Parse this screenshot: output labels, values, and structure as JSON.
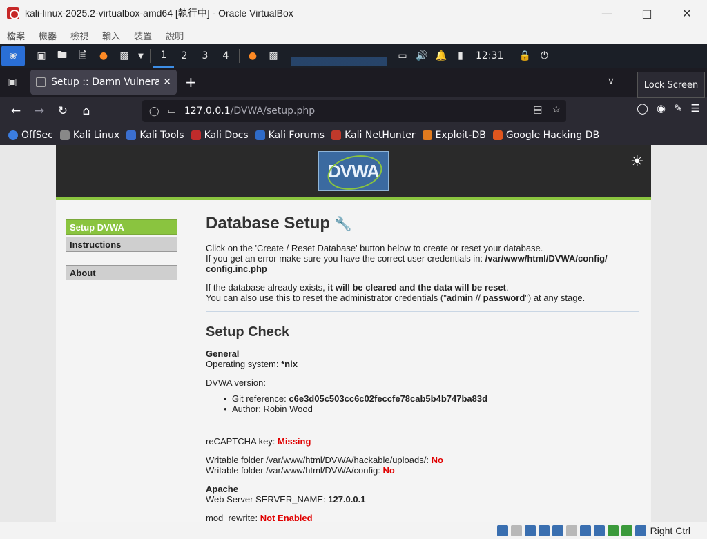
{
  "vbox": {
    "title": "kali-linux-2025.2-virtualbox-amd64 [執行中] - Oracle VirtualBox",
    "menus": [
      "檔案",
      "機器",
      "檢視",
      "輸入",
      "裝置",
      "說明"
    ],
    "host_key": "Right Ctrl"
  },
  "panel": {
    "workspaces": [
      "1",
      "2",
      "3",
      "4"
    ],
    "clock": "12:31"
  },
  "firefox": {
    "tab_title": "Setup :: Damn Vulnerable",
    "tooltip": "Lock Screen",
    "url_host": "127.0.0.1",
    "url_path": "/DVWA/setup.php",
    "bookmarks": [
      "OffSec",
      "Kali Linux",
      "Kali Tools",
      "Kali Docs",
      "Kali Forums",
      "Kali NetHunter",
      "Exploit-DB",
      "Google Hacking DB"
    ]
  },
  "dvwa": {
    "logo_text": "DVWA",
    "menu": [
      "Setup DVWA",
      "Instructions",
      "About"
    ],
    "heading": "Database Setup",
    "intro_1": "Click on the 'Create / Reset Database' button below to create or reset your database.",
    "intro_2": "If you get an error make sure you have the correct user credentials in: ",
    "config_path": "/var/www/html/DVWA/config/ config.inc.php",
    "exists_1": "If the database already exists, ",
    "exists_bold": "it will be cleared and the data will be reset",
    "exists_end": ".",
    "reset_1": "You can also use this to reset the administrator credentials (\"",
    "reset_admin": "admin",
    "reset_sep": " // ",
    "reset_password": "password",
    "reset_end": "\") at any stage.",
    "check_heading": "Setup Check",
    "general": "General",
    "os_label": "Operating system: ",
    "os_value": "*nix",
    "version_label": "DVWA version:",
    "git_label": "Git reference: ",
    "git_value": "c6e3d05c503cc6c02feccfe78cab5b4b747ba83d",
    "author": "Author: Robin Wood",
    "recaptcha_label": "reCAPTCHA key: ",
    "recaptcha_value": "Missing",
    "uploads_label": "Writable folder /var/www/html/DVWA/hackable/uploads/: ",
    "uploads_value": "No",
    "config_label": "Writable folder /var/www/html/DVWA/config: ",
    "config_value": "No",
    "apache": "Apache",
    "server_label": "Web Server SERVER_NAME: ",
    "server_value": "127.0.0.1",
    "rewrite_label": "mod_rewrite: ",
    "rewrite_value": "Not Enabled"
  }
}
